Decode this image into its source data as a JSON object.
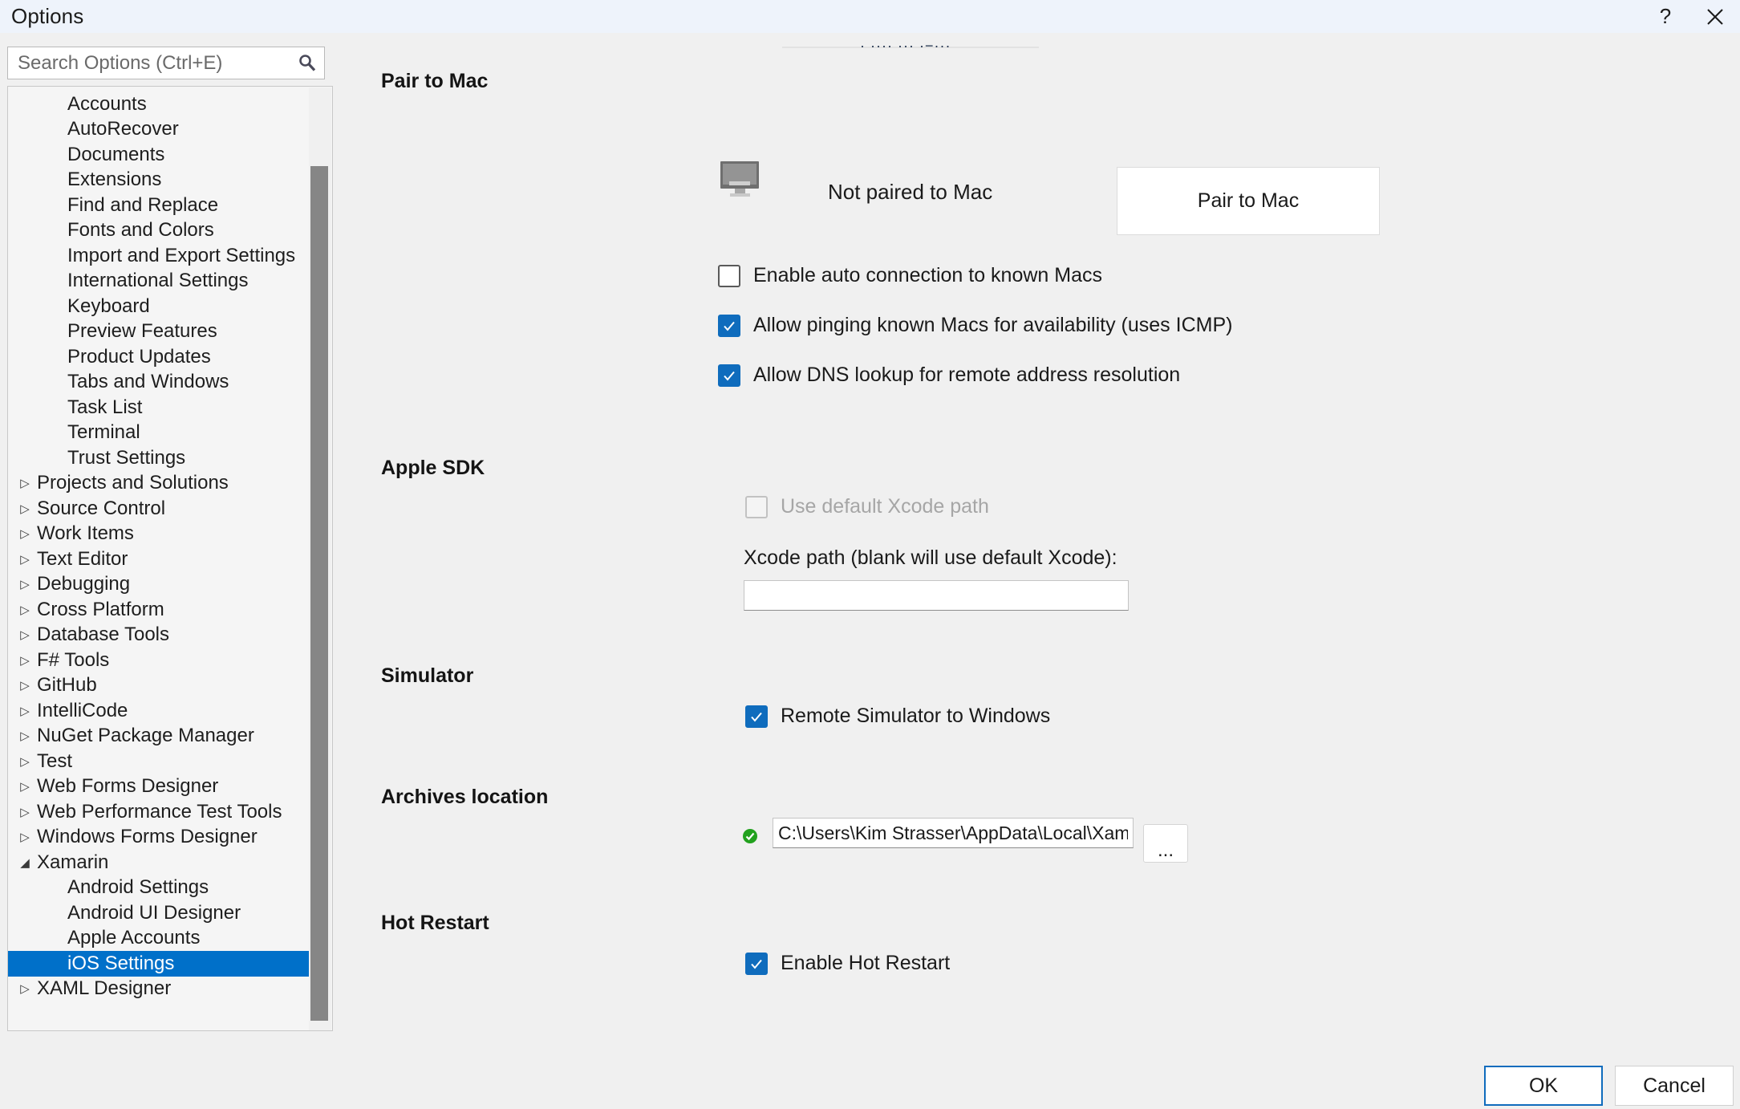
{
  "window": {
    "title": "Options",
    "help_label": "?",
    "close_label": "×",
    "help_icon": "question-mark-icon",
    "close_icon": "close-icon"
  },
  "search": {
    "placeholder": "Search Options (Ctrl+E)",
    "value": "",
    "icon": "search-icon"
  },
  "tree": {
    "selected": "iOS Settings",
    "items": [
      {
        "label": "Accounts",
        "level": 1,
        "expandable": false,
        "expanded": false,
        "selected": false
      },
      {
        "label": "AutoRecover",
        "level": 1,
        "expandable": false,
        "expanded": false,
        "selected": false
      },
      {
        "label": "Documents",
        "level": 1,
        "expandable": false,
        "expanded": false,
        "selected": false
      },
      {
        "label": "Extensions",
        "level": 1,
        "expandable": false,
        "expanded": false,
        "selected": false
      },
      {
        "label": "Find and Replace",
        "level": 1,
        "expandable": false,
        "expanded": false,
        "selected": false
      },
      {
        "label": "Fonts and Colors",
        "level": 1,
        "expandable": false,
        "expanded": false,
        "selected": false
      },
      {
        "label": "Import and Export Settings",
        "level": 1,
        "expandable": false,
        "expanded": false,
        "selected": false
      },
      {
        "label": "International Settings",
        "level": 1,
        "expandable": false,
        "expanded": false,
        "selected": false
      },
      {
        "label": "Keyboard",
        "level": 1,
        "expandable": false,
        "expanded": false,
        "selected": false
      },
      {
        "label": "Preview Features",
        "level": 1,
        "expandable": false,
        "expanded": false,
        "selected": false
      },
      {
        "label": "Product Updates",
        "level": 1,
        "expandable": false,
        "expanded": false,
        "selected": false
      },
      {
        "label": "Tabs and Windows",
        "level": 1,
        "expandable": false,
        "expanded": false,
        "selected": false
      },
      {
        "label": "Task List",
        "level": 1,
        "expandable": false,
        "expanded": false,
        "selected": false
      },
      {
        "label": "Terminal",
        "level": 1,
        "expandable": false,
        "expanded": false,
        "selected": false
      },
      {
        "label": "Trust Settings",
        "level": 1,
        "expandable": false,
        "expanded": false,
        "selected": false
      },
      {
        "label": "Projects and Solutions",
        "level": 0,
        "expandable": true,
        "expanded": false,
        "selected": false
      },
      {
        "label": "Source Control",
        "level": 0,
        "expandable": true,
        "expanded": false,
        "selected": false
      },
      {
        "label": "Work Items",
        "level": 0,
        "expandable": true,
        "expanded": false,
        "selected": false
      },
      {
        "label": "Text Editor",
        "level": 0,
        "expandable": true,
        "expanded": false,
        "selected": false
      },
      {
        "label": "Debugging",
        "level": 0,
        "expandable": true,
        "expanded": false,
        "selected": false
      },
      {
        "label": "Cross Platform",
        "level": 0,
        "expandable": true,
        "expanded": false,
        "selected": false
      },
      {
        "label": "Database Tools",
        "level": 0,
        "expandable": true,
        "expanded": false,
        "selected": false
      },
      {
        "label": "F# Tools",
        "level": 0,
        "expandable": true,
        "expanded": false,
        "selected": false
      },
      {
        "label": "GitHub",
        "level": 0,
        "expandable": true,
        "expanded": false,
        "selected": false
      },
      {
        "label": "IntelliCode",
        "level": 0,
        "expandable": true,
        "expanded": false,
        "selected": false
      },
      {
        "label": "NuGet Package Manager",
        "level": 0,
        "expandable": true,
        "expanded": false,
        "selected": false
      },
      {
        "label": "Test",
        "level": 0,
        "expandable": true,
        "expanded": false,
        "selected": false
      },
      {
        "label": "Web Forms Designer",
        "level": 0,
        "expandable": true,
        "expanded": false,
        "selected": false
      },
      {
        "label": "Web Performance Test Tools",
        "level": 0,
        "expandable": true,
        "expanded": false,
        "selected": false
      },
      {
        "label": "Windows Forms Designer",
        "level": 0,
        "expandable": true,
        "expanded": false,
        "selected": false
      },
      {
        "label": "Xamarin",
        "level": 0,
        "expandable": true,
        "expanded": true,
        "selected": false
      },
      {
        "label": "Android Settings",
        "level": 1,
        "expandable": false,
        "expanded": false,
        "selected": false
      },
      {
        "label": "Android UI Designer",
        "level": 1,
        "expandable": false,
        "expanded": false,
        "selected": false
      },
      {
        "label": "Apple Accounts",
        "level": 1,
        "expandable": false,
        "expanded": false,
        "selected": false
      },
      {
        "label": "iOS Settings",
        "level": 1,
        "expandable": false,
        "expanded": false,
        "selected": true
      },
      {
        "label": "XAML Designer",
        "level": 0,
        "expandable": true,
        "expanded": false,
        "selected": false
      }
    ],
    "collapsed_arrow": "▷",
    "expanded_arrow": "◢"
  },
  "content": {
    "pair_to_mac": {
      "heading": "Pair to Mac",
      "status": "Not paired to Mac",
      "button": "Pair to Mac",
      "monitor_icon": "monitor-icon",
      "checkboxes": [
        {
          "label": "Enable auto connection to known Macs",
          "checked": false,
          "disabled": false
        },
        {
          "label": "Allow pinging known Macs for availability (uses ICMP)",
          "checked": true,
          "disabled": false
        },
        {
          "label": "Allow DNS lookup for remote address resolution",
          "checked": true,
          "disabled": false
        }
      ]
    },
    "apple_sdk": {
      "heading": "Apple SDK",
      "use_default_label": "Use default Xcode path",
      "use_default_checked": false,
      "use_default_disabled": true,
      "path_label": "Xcode path (blank will use default Xcode):",
      "path_value": "",
      "path_placeholder": ""
    },
    "simulator": {
      "heading": "Simulator",
      "remote_label": "Remote Simulator to Windows",
      "remote_checked": true
    },
    "archives": {
      "heading": "Archives location",
      "path_value": "C:\\Users\\Kim Strasser\\AppData\\Local\\Xamarin\\Archives",
      "browse_label": "...",
      "valid_icon": "green-check-icon"
    },
    "hot_restart": {
      "heading": "Hot Restart",
      "enable_label": "Enable Hot Restart",
      "enable_checked": true
    }
  },
  "footer": {
    "ok_label": "OK",
    "cancel_label": "Cancel"
  },
  "colors": {
    "accent": "#0f6cbd",
    "selection": "#0070c9",
    "titlebar": "#eef3fb",
    "surface": "#f0f0f0",
    "valid_green": "#22a11e"
  }
}
